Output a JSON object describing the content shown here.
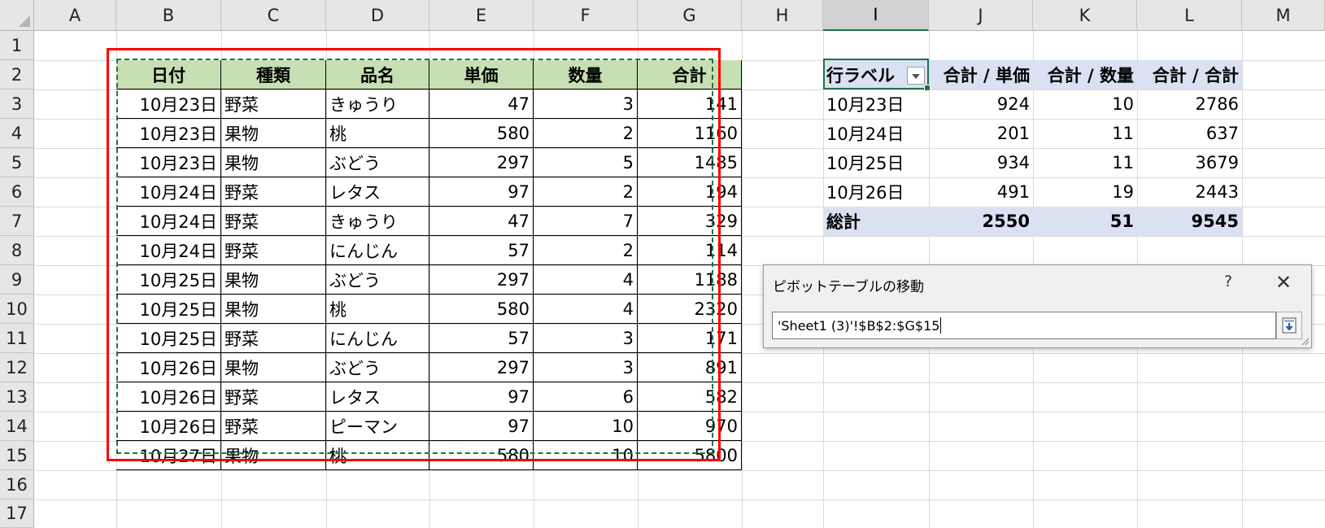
{
  "columns": [
    "A",
    "B",
    "C",
    "D",
    "E",
    "F",
    "G",
    "H",
    "I",
    "J",
    "K",
    "L",
    "M"
  ],
  "rows": [
    "1",
    "2",
    "3",
    "4",
    "5",
    "6",
    "7",
    "8",
    "9",
    "10",
    "11",
    "12",
    "13",
    "14",
    "15",
    "16",
    "17"
  ],
  "table": {
    "headers": [
      "日付",
      "種類",
      "品名",
      "単価",
      "数量",
      "合計"
    ],
    "rows": [
      [
        "10月23日",
        "野菜",
        "きゅうり",
        "47",
        "3",
        "141"
      ],
      [
        "10月23日",
        "果物",
        "桃",
        "580",
        "2",
        "1160"
      ],
      [
        "10月23日",
        "果物",
        "ぶどう",
        "297",
        "5",
        "1485"
      ],
      [
        "10月24日",
        "野菜",
        "レタス",
        "97",
        "2",
        "194"
      ],
      [
        "10月24日",
        "野菜",
        "きゅうり",
        "47",
        "7",
        "329"
      ],
      [
        "10月24日",
        "野菜",
        "にんじん",
        "57",
        "2",
        "114"
      ],
      [
        "10月25日",
        "果物",
        "ぶどう",
        "297",
        "4",
        "1188"
      ],
      [
        "10月25日",
        "果物",
        "桃",
        "580",
        "4",
        "2320"
      ],
      [
        "10月25日",
        "野菜",
        "にんじん",
        "57",
        "3",
        "171"
      ],
      [
        "10月26日",
        "果物",
        "ぶどう",
        "297",
        "3",
        "891"
      ],
      [
        "10月26日",
        "野菜",
        "レタス",
        "97",
        "6",
        "582"
      ],
      [
        "10月26日",
        "野菜",
        "ピーマン",
        "97",
        "10",
        "970"
      ],
      [
        "10月27日",
        "果物",
        "桃",
        "580",
        "10",
        "5800"
      ]
    ]
  },
  "pivot": {
    "headers": [
      "行ラベル",
      "合計 / 単価",
      "合計 / 数量",
      "合計 / 合計"
    ],
    "rows": [
      [
        "10月23日",
        "924",
        "10",
        "2786"
      ],
      [
        "10月24日",
        "201",
        "11",
        "637"
      ],
      [
        "10月25日",
        "934",
        "11",
        "3679"
      ],
      [
        "10月26日",
        "491",
        "19",
        "2443"
      ]
    ],
    "total": [
      "総計",
      "2550",
      "51",
      "9545"
    ]
  },
  "dialog": {
    "title": "ピボットテーブルの移動",
    "help": "?",
    "close": "✕",
    "range_value": "'Sheet1 (3)'!$B$2:$G$15"
  },
  "colors": {
    "table_header": "#c6e0b4",
    "pivot_header": "#d9e1f2",
    "highlight_box": "#ff0000",
    "marquee": "#217346"
  }
}
